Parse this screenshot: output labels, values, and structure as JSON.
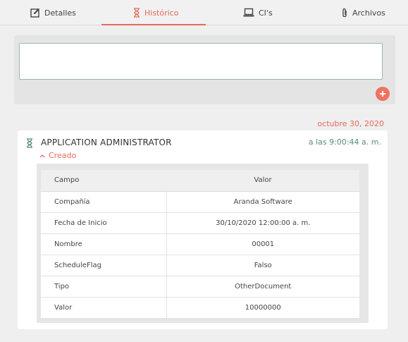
{
  "tabs": [
    {
      "label": "Detalles",
      "icon": "edit-icon"
    },
    {
      "label": "Histórico",
      "icon": "hourglass-icon",
      "active": true
    },
    {
      "label": "CI's",
      "icon": "laptop-icon"
    },
    {
      "label": "Archivos",
      "icon": "paperclip-icon"
    }
  ],
  "comment": {
    "value": "",
    "add_icon": "plus-icon"
  },
  "history": {
    "date": "octubre 30, 2020",
    "entry": {
      "user": "APPLICATION ADMINISTRATOR",
      "time": "a las 9:00:44 a. m.",
      "action": "Creado",
      "columns": [
        "Campo",
        "Valor"
      ],
      "rows": [
        {
          "field": "Compañía",
          "value": "Aranda Software"
        },
        {
          "field": "Fecha de Inicio",
          "value": "30/10/2020 12:00:00 a. m."
        },
        {
          "field": "Nombre",
          "value": "00001"
        },
        {
          "field": "ScheduleFlag",
          "value": "Falso"
        },
        {
          "field": "Tipo",
          "value": "OtherDocument"
        },
        {
          "field": "Valor",
          "value": "10000000"
        }
      ]
    }
  },
  "colors": {
    "accent": "#e66a5a",
    "teal": "#5a8a7f",
    "add_button": "#ee7360"
  }
}
